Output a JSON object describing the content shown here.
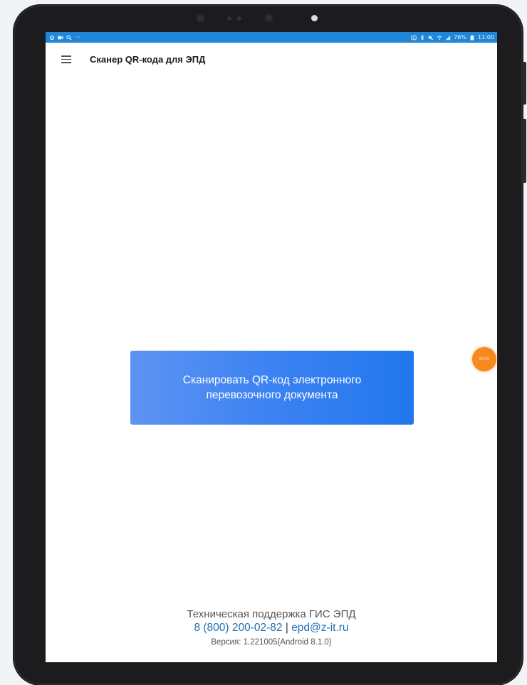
{
  "statusbar": {
    "battery": "76%",
    "time": "11:00",
    "left_icons": [
      "settings-icon",
      "video-icon",
      "search-icon"
    ],
    "left_more": "···"
  },
  "appbar": {
    "title": "Сканер QR-кода для ЭПД"
  },
  "main": {
    "scan_button_label": "Сканировать QR-код электронного перевозочного документа"
  },
  "footer": {
    "support_title": "Техническая поддержка ГИС ЭПД",
    "phone": "8 (800) 200-02-82",
    "separator": "|",
    "email": "epd@z-it.ru",
    "version": "Версия: 1.221005(Android 8.1.0)"
  },
  "overlay": {
    "bubble_text": "00:00"
  },
  "colors": {
    "statusbar": "#1f86d8",
    "button_gradient_start": "#5d93f3",
    "button_gradient_end": "#2277ee",
    "link": "#1f6fb4",
    "bubble": "#f68a1e"
  }
}
